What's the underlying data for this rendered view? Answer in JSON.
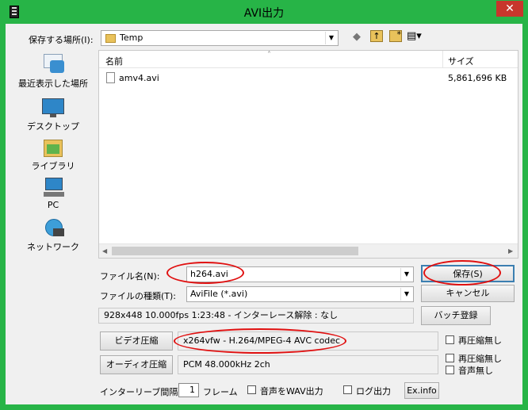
{
  "window": {
    "title": "AVI出力",
    "close_glyph": "✕"
  },
  "toolbar": {
    "save_in_label": "保存する場所(I):",
    "folder": "Temp",
    "back_glyph": "◆",
    "up_glyph": "↑",
    "newfolder_glyph": "*",
    "view_glyph": "▤▾"
  },
  "places": [
    {
      "label": "最近表示した場所",
      "icon": "recent-places-icon"
    },
    {
      "label": "デスクトップ",
      "icon": "desktop-icon"
    },
    {
      "label": "ライブラリ",
      "icon": "libraries-icon"
    },
    {
      "label": "PC",
      "icon": "pc-icon"
    },
    {
      "label": "ネットワーク",
      "icon": "network-icon"
    }
  ],
  "filelist": {
    "headers": {
      "name": "名前",
      "size": "サイズ",
      "sort_glyph": "˄"
    },
    "files": [
      {
        "name": "amv4.avi",
        "size": "5,861,696 KB"
      }
    ]
  },
  "filename": {
    "label": "ファイル名(N):",
    "value": "h264.avi"
  },
  "filetype": {
    "label": "ファイルの種類(T):",
    "value": "AviFile (*.avi)"
  },
  "buttons": {
    "save": "保存(S)",
    "cancel": "キャンセル",
    "batch": "バッチ登録",
    "video": "ビデオ圧縮",
    "audio": "オーディオ圧縮",
    "exinfo": "Ex.info"
  },
  "info_text": "928x448  10.000fps  1:23:48  -  インターレース解除 : なし",
  "video_codec": "x264vfw - H.264/MPEG-4 AVC codec",
  "audio_codec": "PCM 48.000kHz 2ch",
  "options": {
    "video_no_recompress": "再圧縮無し",
    "audio_no_recompress": "再圧縮無し",
    "no_audio": "音声無し",
    "interleave_label": "インターリーブ間隔 :",
    "interleave_value": "1",
    "interleave_unit": "フレーム",
    "wav_output": "音声をWAV出力",
    "log_output": "ログ出力"
  },
  "colors": {
    "frame": "#27b447",
    "highlight_ring": "#e01010",
    "close": "#c7362c"
  }
}
